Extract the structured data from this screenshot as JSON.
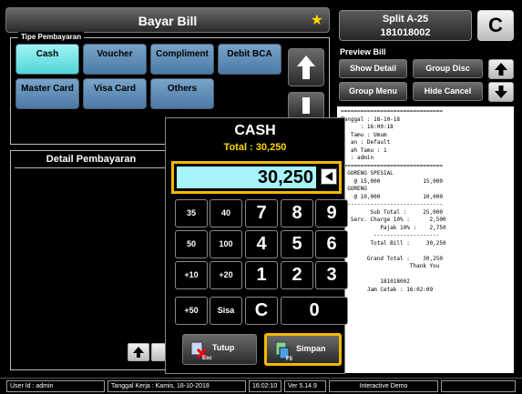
{
  "header": {
    "title": "Bayar Bill",
    "star_icon": "star-icon"
  },
  "payment_types": {
    "title": "Tipe Pembayaran",
    "buttons": [
      {
        "label": "Cash",
        "active": true
      },
      {
        "label": "Voucher"
      },
      {
        "label": "Compliment"
      },
      {
        "label": "Debit BCA"
      },
      {
        "label": "Master Card"
      },
      {
        "label": "Visa Card"
      },
      {
        "label": "Others"
      }
    ]
  },
  "detail": {
    "title": "Detail Pembayaran"
  },
  "split": {
    "name": "Split A-25",
    "number": "181018002",
    "clear_label": "C"
  },
  "preview": {
    "title": "Preview Bill",
    "show_detail": "Show Detail",
    "group_disc": "Group Disc",
    "group_menu": "Group Menu",
    "hide_cancel": "Hide Cancel",
    "receipt_lines": [
      "===============================",
      "Tanggal : 18-10-18",
      "      : 16:00:18",
      "   Tamu : Umum",
      "   an : Default",
      "   ah Tamu : 1",
      "   : admin",
      "===============================",
      "  GORENG SPESIAL",
      "    @ 15,000             15,000",
      "  GORENG",
      "    @ 10,000             10,000",
      "  -----------------------------",
      "         Sub Total :     25,000",
      "   Serv. Charge 10% :      2,500",
      "            Pajak 10% :    2,750",
      "          --------------------",
      "         Total Bill :     30,250",
      "",
      "        Grand Total :    30,250",
      "                     Thank You",
      "",
      "            181018002",
      "        Jam Cetak : 16:02:09"
    ]
  },
  "cash_dialog": {
    "title": "CASH",
    "total_text": "Total : 30,250",
    "amount": "30,250",
    "keys": [
      "35",
      "40",
      "7",
      "8",
      "9",
      "50",
      "100",
      "4",
      "5",
      "6",
      "+10",
      "+20",
      "1",
      "2",
      "3",
      "+50",
      "Sisa",
      "C",
      "0"
    ],
    "tutup": {
      "label": "Tutup",
      "hint": "Esc"
    },
    "simpan": {
      "label": "Simpan",
      "hint": "F5"
    }
  },
  "status_bar": {
    "user": "User Id : admin",
    "work_date": "Tanggal Kerja : Kamis, 18-10-2018",
    "time": "16:02:10",
    "version": "Ver 5.14.9",
    "mode": "Interactive Demo"
  }
}
